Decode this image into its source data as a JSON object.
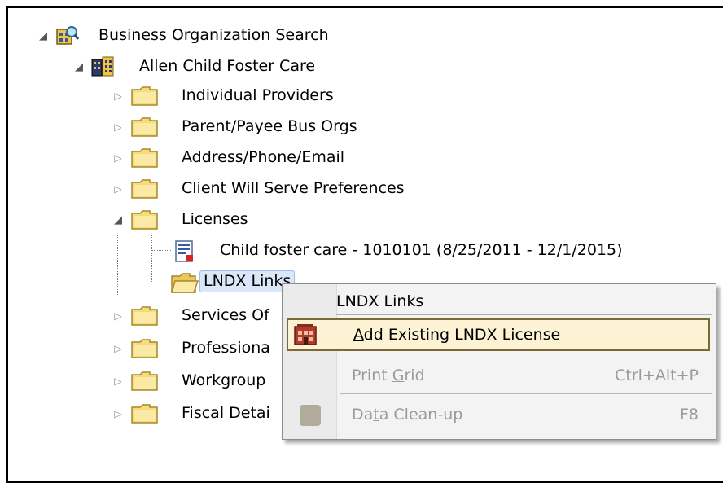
{
  "tree": {
    "root": {
      "label": "Business Organization Search",
      "icon": "search-org-icon",
      "expanded": true
    },
    "org": {
      "label": "Allen Child Foster Care",
      "icon": "building-icon",
      "expanded": true
    },
    "folders": [
      {
        "label": "Individual Providers",
        "expanded": false
      },
      {
        "label": "Parent/Payee Bus Orgs",
        "expanded": false
      },
      {
        "label": "Address/Phone/Email",
        "expanded": false
      },
      {
        "label": "Client Will Serve Preferences",
        "expanded": false
      },
      {
        "label": "Licenses",
        "expanded": true
      },
      {
        "label": "Services Of",
        "expanded": false
      },
      {
        "label": "Professiona",
        "expanded": false
      },
      {
        "label": "Workgroup",
        "expanded": false
      },
      {
        "label": "Fiscal Detai",
        "expanded": false
      }
    ],
    "license_children": [
      {
        "label": "Child foster care - 1010101 (8/25/2011 - 12/1/2015)",
        "icon": "license-document-icon"
      },
      {
        "label": "LNDX Links",
        "icon": "open-folder-icon",
        "selected": true
      }
    ]
  },
  "context_menu": {
    "title": "LNDX Links",
    "items": [
      {
        "label": "Add Existing LNDX License",
        "accelerator": "A",
        "shortcut": "",
        "enabled": true,
        "highlighted": true,
        "icon": "license-building-icon"
      },
      {
        "label": "Print Grid",
        "accelerator": "G",
        "shortcut": "Ctrl+Alt+P",
        "enabled": false,
        "highlighted": false,
        "icon": ""
      },
      {
        "label": "Data Clean-up",
        "accelerator": "t",
        "shortcut": "F8",
        "enabled": false,
        "highlighted": false,
        "icon": "cleanup-icon"
      }
    ]
  },
  "colors": {
    "folder": "#f5dc7a",
    "folder_edge": "#a8892e",
    "selection_bg": "#d9e7f9",
    "menu_highlight": "#fdf3d4"
  }
}
